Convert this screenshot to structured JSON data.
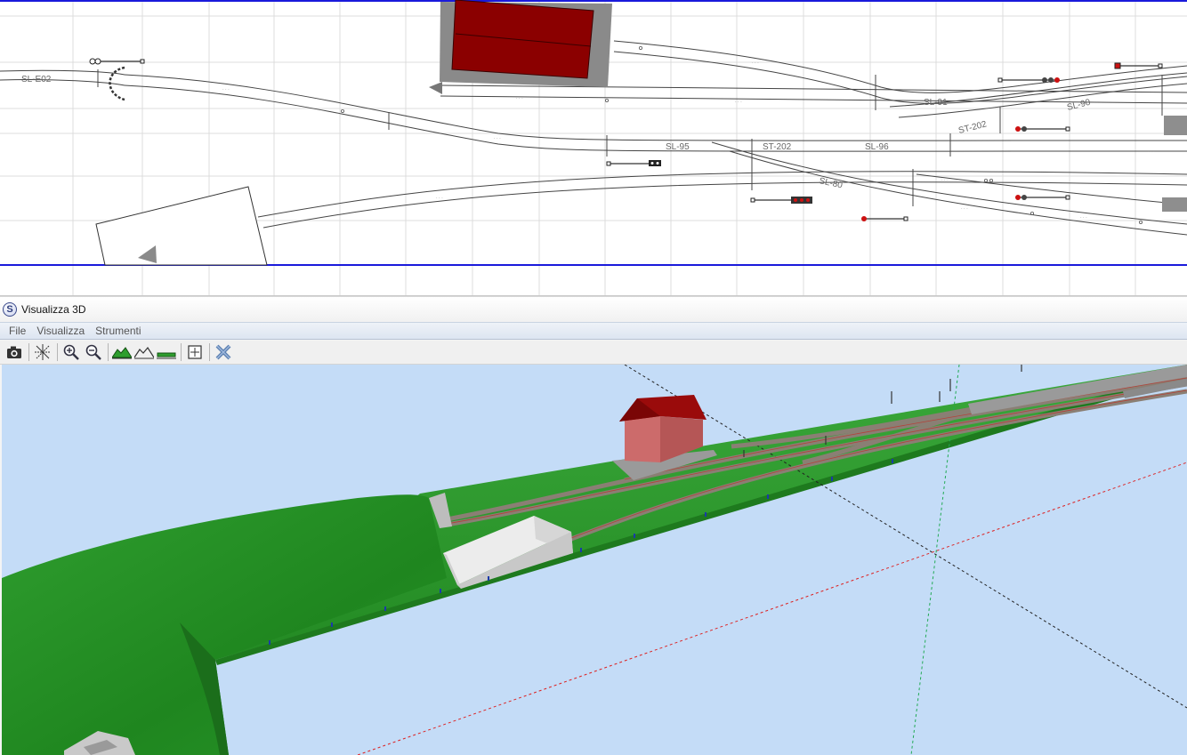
{
  "plan": {
    "labels": {
      "sl_e02": "SL-E02",
      "sl_91": "SL-91",
      "sl_90": "SL-90",
      "st_202_right": "ST-202",
      "sl_95": "SL-95",
      "st_202_mid": "ST-202",
      "sl_96": "SL-96",
      "sl_80": "SL-80"
    },
    "colors": {
      "border_blue": "#1a1adb",
      "grid": "#dcdcdc",
      "building_roof": "#8b0000",
      "building_base": "#8a8a8a",
      "signal_red": "#cc1111"
    }
  },
  "window": {
    "title": "Visualizza 3D",
    "app_icon_letter": "S",
    "menu": [
      "File",
      "Visualizza",
      "Strumenti"
    ],
    "toolbar": [
      {
        "icon": "camera-icon"
      },
      {
        "sep": true
      },
      {
        "icon": "axes-icon"
      },
      {
        "sep": true
      },
      {
        "icon": "zoom-in-icon"
      },
      {
        "icon": "zoom-out-icon"
      },
      {
        "sep": true
      },
      {
        "icon": "terrain-icon"
      },
      {
        "icon": "terrain-outline-icon"
      },
      {
        "icon": "flat-ground-icon"
      },
      {
        "sep": true
      },
      {
        "icon": "fit-view-icon"
      },
      {
        "sep": true
      },
      {
        "icon": "close-tool-icon"
      }
    ]
  },
  "scene": {
    "colors": {
      "sky": "#c4dcf7",
      "grass": "#2f9e2f",
      "grass_dark": "#1e7a1e",
      "ballast": "#8a7f74",
      "house_roof": "#9a0b0b",
      "house_wall": "#cc6b6b",
      "shed": "#e6e6e6"
    }
  }
}
